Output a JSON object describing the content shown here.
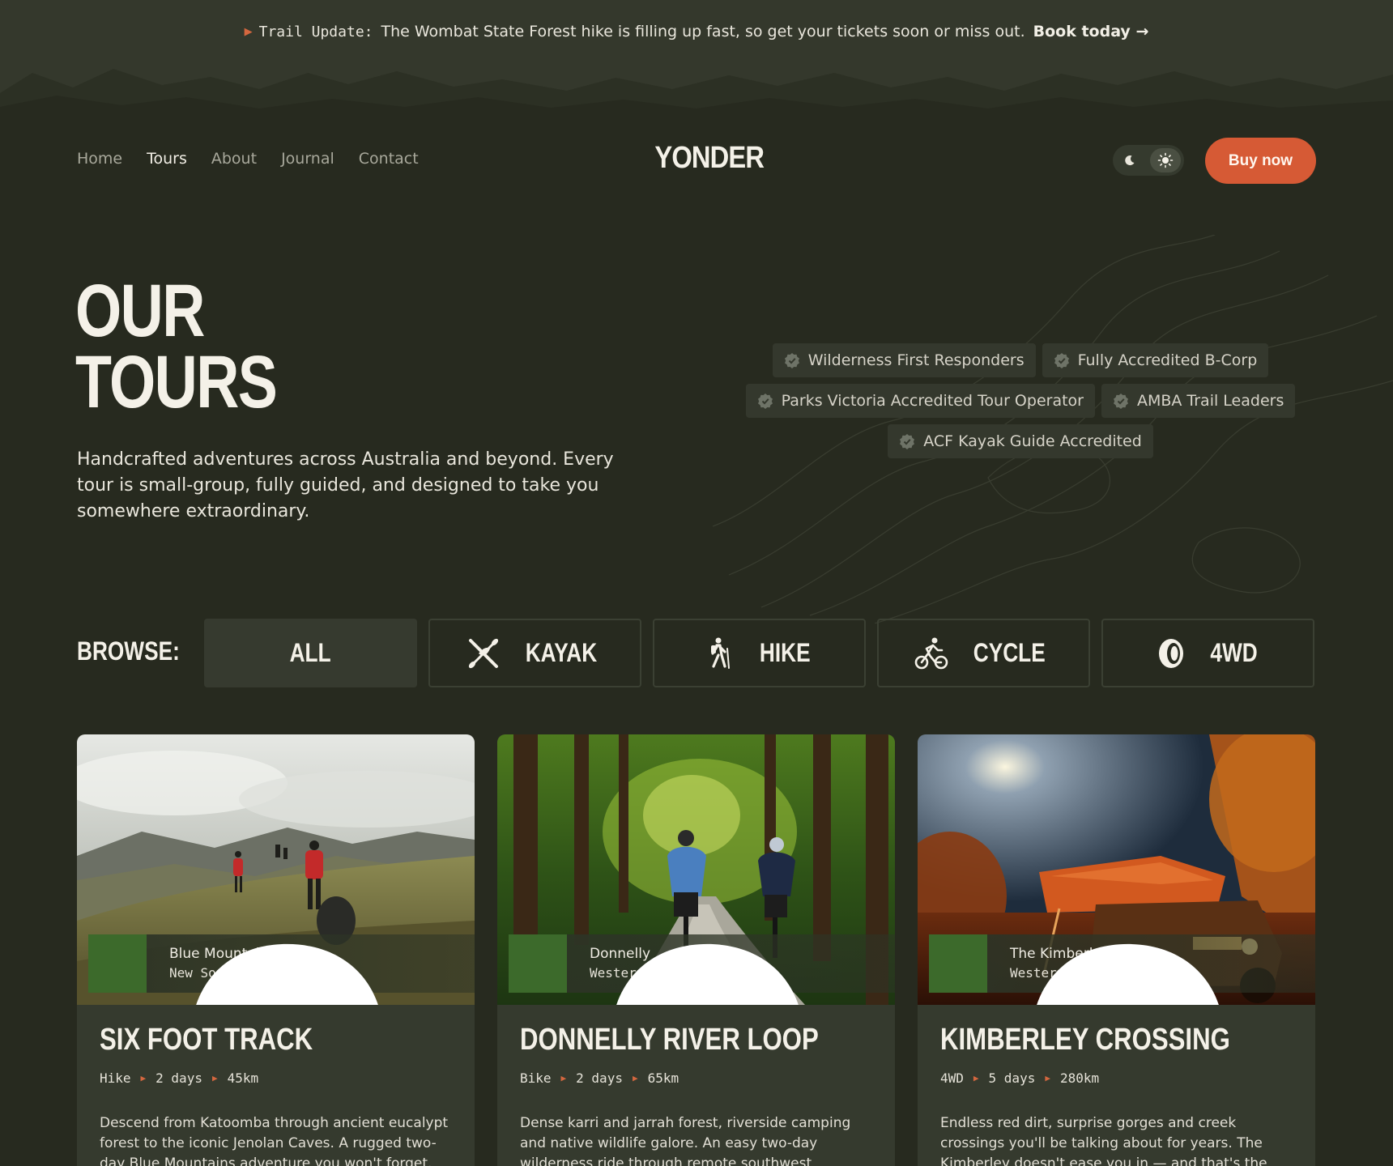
{
  "announcement": {
    "label": "Trail Update:",
    "message": "The Wombat State Forest hike is filling up fast, so get your tickets soon or miss out.",
    "link": "Book today",
    "link_icon": "arrow-right-icon"
  },
  "nav": {
    "items": [
      {
        "label": "Home",
        "active": false
      },
      {
        "label": "Tours",
        "active": true
      },
      {
        "label": "About",
        "active": false
      },
      {
        "label": "Journal",
        "active": false
      },
      {
        "label": "Contact",
        "active": false
      }
    ]
  },
  "brand": {
    "logo": "YONDER"
  },
  "header": {
    "theme_toggle": {
      "dark_icon": "moon-icon",
      "light_icon": "sun-icon",
      "selected": "light"
    },
    "cta": "Buy now"
  },
  "hero": {
    "title_line1": "OUR",
    "title_line2": "TOURS",
    "subtitle": "Handcrafted adventures across Australia and beyond. Every tour is small-group, fully guided, and designed to take you somewhere extraordinary."
  },
  "badges": [
    "Wilderness First Responders",
    "Fully Accredited B-Corp",
    "Parks Victoria Accredited Tour Operator",
    "AMBA Trail Leaders",
    "ACF Kayak Guide Accredited"
  ],
  "browse": {
    "label": "BROWSE:",
    "filters": [
      {
        "label": "ALL",
        "icon": "",
        "active": true
      },
      {
        "label": "KAYAK",
        "icon": "kayak-icon",
        "active": false
      },
      {
        "label": "HIKE",
        "icon": "hiker-icon",
        "active": false
      },
      {
        "label": "CYCLE",
        "icon": "cyclist-icon",
        "active": false
      },
      {
        "label": "4WD",
        "icon": "tyre-icon",
        "active": false
      }
    ]
  },
  "tours": [
    {
      "title": "SIX FOOT TRACK",
      "location": "Blue Mountains",
      "region": "New South Wales",
      "type": "Hike",
      "duration": "2 days",
      "distance": "45km",
      "description": "Descend from Katoomba through ancient eucalypt forest to the iconic Jenolan Caves.  A rugged two-day Blue Mountains adventure you won't forget."
    },
    {
      "title": "DONNELLY RIVER LOOP",
      "location": "Donnelly",
      "region": "Western Australia",
      "type": "Bike",
      "duration": "2 days",
      "distance": "65km",
      "description": "Dense karri and jarrah forest, riverside camping and native wildlife galore.  An easy two-day wilderness ride through remote southwest Australia."
    },
    {
      "title": "KIMBERLEY CROSSING",
      "location": "The Kimberley",
      "region": "Western Australia",
      "type": "4WD",
      "duration": "5 days",
      "distance": "280km",
      "description": "Endless red dirt, surprise gorges and creek crossings you'll be talking about for years. The Kimberley doesn't ease you in — and that's the point."
    }
  ],
  "colors": {
    "background": "#272a1f",
    "accent": "#d65a35",
    "card": "#353a2e",
    "pin": "#3c6a2b"
  }
}
